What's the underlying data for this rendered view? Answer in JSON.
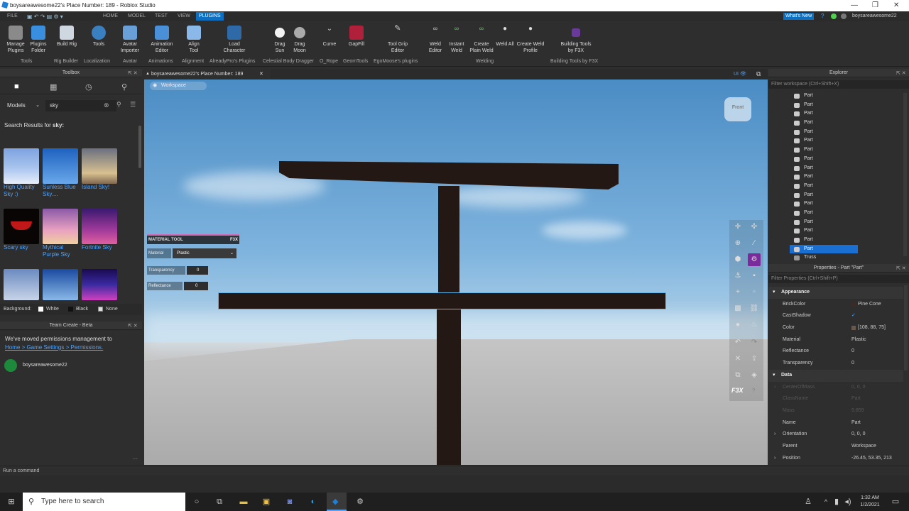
{
  "window": {
    "title": "boysareawesome22's Place Number: 189 - Roblox Studio"
  },
  "menu": {
    "items": [
      "FILE",
      "HOME",
      "MODEL",
      "TEST",
      "VIEW",
      "PLUGINS"
    ],
    "active": "PLUGINS",
    "whats_new": "What's New",
    "user": "boysareawesome22"
  },
  "ribbon": {
    "buttons": [
      {
        "label": "Manage Plugins",
        "icon": "gear-icon"
      },
      {
        "label": "Plugins Folder",
        "icon": "folder-icon"
      },
      {
        "label": "Build Rig",
        "icon": "rig-icon"
      },
      {
        "label": "Tools",
        "icon": "globe-icon"
      },
      {
        "label": "Avatar Importer",
        "icon": "avatar-icon"
      },
      {
        "label": "Animation Editor",
        "icon": "animation-icon"
      },
      {
        "label": "Align Tool",
        "icon": "align-icon"
      },
      {
        "label": "Load Character",
        "icon": "character-icon"
      },
      {
        "label": "Drag Sun",
        "icon": "sun-icon"
      },
      {
        "label": "Drag Moon",
        "icon": "moon-icon"
      },
      {
        "label": "Curve",
        "icon": "curve-icon"
      },
      {
        "label": "GapFill",
        "icon": "gapfill-icon"
      },
      {
        "label": "Tool Grip Editor",
        "icon": "grip-icon"
      },
      {
        "label": "Weld Editor",
        "icon": "weld-icon"
      },
      {
        "label": "Instant Weld",
        "icon": "weld-icon"
      },
      {
        "label": "Create Plain Weld",
        "icon": "weld-icon"
      },
      {
        "label": "Weld All",
        "icon": "weld-icon"
      },
      {
        "label": "Create Weld Profile",
        "icon": "weld-icon"
      },
      {
        "label": "Building Tools by F3X",
        "icon": "f3x-icon"
      }
    ],
    "groups": [
      "Tools",
      "Rig Builder",
      "Localization",
      "Avatar",
      "Animations",
      "Alignment",
      "AlreadyPro's Plugins",
      "Celestial Body Dragger",
      "O_Rope",
      "GeomTools",
      "EgoMoose's plugins",
      "Welding",
      "Building Tools by F3X"
    ]
  },
  "toolbox": {
    "title": "Toolbox",
    "category": "Models",
    "search_value": "sky",
    "results_label": "Search Results for",
    "results_query": "sky:",
    "items": [
      {
        "label": "High Quality Sky :)",
        "color": "#6a8fd0"
      },
      {
        "label": "Sunless Blue Sky....",
        "color": "#2f7fd6"
      },
      {
        "label": "Island Sky!",
        "color": "#b09a70"
      },
      {
        "label": "Scary sky",
        "color": "#120808"
      },
      {
        "label": "Mythical Purple Sky",
        "color": "#c77fb0"
      },
      {
        "label": "Fortnite Sky",
        "color": "#5a2a8a"
      },
      {
        "label": "",
        "color": "#8aa4c8"
      },
      {
        "label": "",
        "color": "#2a64b0"
      },
      {
        "label": "",
        "color": "#2a1a70"
      }
    ],
    "background_label": "Background:",
    "backgrounds": [
      "White",
      "Black",
      "None"
    ]
  },
  "team_create": {
    "title": "Team Create - Beta",
    "message": "We've moved permissions management to",
    "link": "Home > Game Settings > Permissions.",
    "user": "boysareawesome22"
  },
  "tab": {
    "label": "boysareawesome22's Place Number: 189"
  },
  "viewport": {
    "breadcrumb": "Workspace",
    "view_cube": "Front",
    "material_tool": {
      "title": "MATERIAL TOOL",
      "brand": "F3X",
      "material_label": "Material",
      "material_value": "Plastic",
      "transparency_label": "Transparency",
      "transparency_value": "0",
      "reflectance_label": "Reflectance",
      "reflectance_value": "0"
    },
    "f3x_label": "F3X"
  },
  "explorer": {
    "title": "Explorer",
    "filter_placeholder": "Filter workspace (Ctrl+Shift+X)",
    "items": [
      "Part",
      "Part",
      "Part",
      "Part",
      "Part",
      "Part",
      "Part",
      "Part",
      "Part",
      "Part",
      "Part",
      "Part",
      "Part",
      "Part",
      "Part",
      "Part",
      "Part",
      "Part",
      "Truss"
    ],
    "selected_index": 17
  },
  "properties": {
    "title": "Properties - Part \"Part\"",
    "filter_placeholder": "Filter Properties (Ctrl+Shift+P)",
    "sections": {
      "appearance": "Appearance",
      "data": "Data"
    },
    "appearance": [
      {
        "k": "BrickColor",
        "v": "Pine Cone"
      },
      {
        "k": "CastShadow",
        "v": "✓"
      },
      {
        "k": "Color",
        "v": "[108, 88, 75]"
      },
      {
        "k": "Material",
        "v": "Plastic"
      },
      {
        "k": "Reflectance",
        "v": "0"
      },
      {
        "k": "Transparency",
        "v": "0"
      }
    ],
    "data": [
      {
        "k": "CenterOfMass",
        "v": "0, 0, 0"
      },
      {
        "k": "ClassName",
        "v": "Part"
      },
      {
        "k": "Mass",
        "v": "9.859"
      },
      {
        "k": "Name",
        "v": "Part"
      },
      {
        "k": "Orientation",
        "v": "0, 0, 0"
      },
      {
        "k": "Parent",
        "v": "Workspace"
      },
      {
        "k": "Position",
        "v": "-26.45, 53.35, 213"
      }
    ],
    "brickcolor_swatch": "#3b2b22",
    "color_swatch": "#6c584b"
  },
  "command_bar": {
    "placeholder": "Run a command"
  },
  "taskbar": {
    "search_placeholder": "Type here to search",
    "time": "1:32 AM",
    "date": "1/2/2021"
  }
}
